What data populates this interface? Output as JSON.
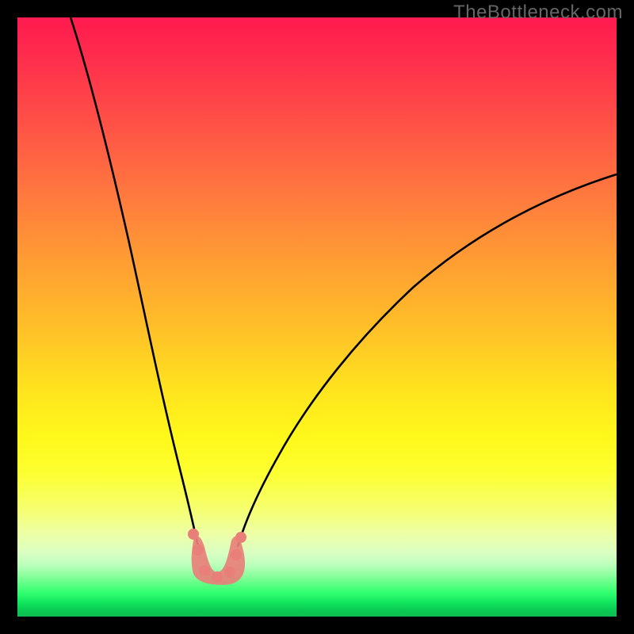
{
  "watermark": {
    "text": "TheBottleneck.com"
  },
  "chart_data": {
    "type": "line",
    "title": "",
    "xlabel": "",
    "ylabel": "",
    "xlim": [
      0,
      100
    ],
    "ylim": [
      0,
      100
    ],
    "legend": false,
    "grid": false,
    "series": [
      {
        "name": "left-curve",
        "x": [
          9,
          11,
          13,
          15,
          17,
          19,
          21,
          23,
          25,
          27,
          28.5,
          30,
          31
        ],
        "values": [
          100,
          87,
          74,
          62,
          51,
          41,
          32,
          23.5,
          16,
          11,
          8.5,
          7,
          7
        ]
      },
      {
        "name": "right-curve",
        "x": [
          35,
          36,
          37.5,
          40,
          44,
          50,
          58,
          68,
          80,
          92,
          100
        ],
        "values": [
          7,
          7,
          8.5,
          11.5,
          16,
          23,
          31,
          40,
          49,
          56,
          60
        ]
      },
      {
        "name": "bottom-band",
        "x": [
          29,
          30,
          31,
          32,
          33,
          34,
          35,
          35.5,
          36
        ],
        "values": [
          7,
          6,
          5.5,
          5.5,
          5.5,
          5.5,
          6,
          7,
          8.5
        ]
      }
    ],
    "background_gradient_stops": [
      {
        "pct": 0,
        "color": "#ff1a4f"
      },
      {
        "pct": 40,
        "color": "#ff9b33"
      },
      {
        "pct": 70,
        "color": "#fff81a"
      },
      {
        "pct": 96,
        "color": "#33ff70"
      },
      {
        "pct": 100,
        "color": "#0fbe51"
      }
    ]
  }
}
